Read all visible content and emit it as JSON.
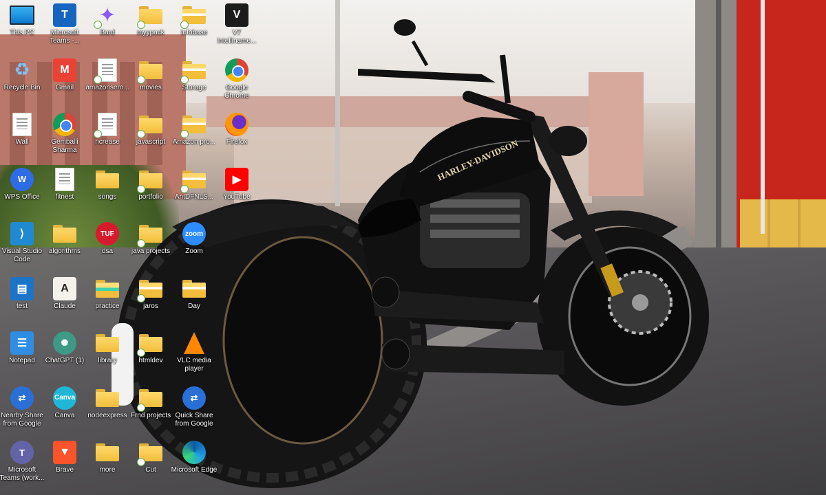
{
  "desktop": {
    "icons": [
      {
        "label": "This PC",
        "kind": "monitor",
        "color": "#1e90ff"
      },
      {
        "label": "Recycle Bin",
        "kind": "recycle",
        "color": "#7bc5ff"
      },
      {
        "label": "Wall",
        "kind": "doc",
        "color": "#ffffff"
      },
      {
        "label": "WPS Office",
        "kind": "round",
        "glyph": "W",
        "color": "#2e6be6"
      },
      {
        "label": "Visual Studio Code",
        "kind": "square",
        "glyph": "⟩",
        "color": "#1f8ad2"
      },
      {
        "label": "test",
        "kind": "square",
        "glyph": "▤",
        "color": "#1c74c9"
      },
      {
        "label": "Notepad",
        "kind": "square",
        "glyph": "☰",
        "color": "#2f8de4"
      },
      {
        "label": "Nearby Share from Google",
        "kind": "round",
        "glyph": "⇄",
        "color": "#2a6fd6"
      },
      {
        "label": "Microsoft Teams (work...",
        "kind": "round",
        "glyph": "T",
        "color": "#6264a7"
      },
      {
        "label": "Microsoft Teams -...",
        "kind": "square",
        "glyph": "T",
        "color": "#1565c0"
      },
      {
        "label": "Gmail",
        "kind": "square",
        "glyph": "M",
        "color": "#ea4335"
      },
      {
        "label": "Gemballi Sharma",
        "kind": "chrome",
        "color": "#4285f4"
      },
      {
        "label": "fitnest",
        "kind": "doc",
        "color": "#ffffff"
      },
      {
        "label": "algorithms",
        "kind": "folder",
        "color": "#f2be3b"
      },
      {
        "label": "Claude",
        "kind": "square",
        "glyph": "A",
        "color": "#f5f2ee"
      },
      {
        "label": "ChatGPT (1)",
        "kind": "round",
        "glyph": "✺",
        "color": "#3c9a85"
      },
      {
        "label": "Canva",
        "kind": "round",
        "glyph": "Canva",
        "color": "#20b7d6"
      },
      {
        "label": "Brave",
        "kind": "square",
        "glyph": "▼",
        "color": "#fb542b"
      },
      {
        "label": "Bard",
        "kind": "sparkle",
        "color": "#8a5cf6"
      },
      {
        "label": "amazonsero...",
        "kind": "doc",
        "color": "#ffffff"
      },
      {
        "label": "ncrease",
        "kind": "doc",
        "color": "#ffffff"
      },
      {
        "label": "songs",
        "kind": "folder",
        "color": "#f2be3b"
      },
      {
        "label": "dsa",
        "kind": "round",
        "glyph": "TUF",
        "color": "#d81b2c"
      },
      {
        "label": "practice",
        "kind": "folder-green",
        "color": "#3fd3b0"
      },
      {
        "label": "library",
        "kind": "folder",
        "color": "#f2be3b"
      },
      {
        "label": "nodeexpress",
        "kind": "folder",
        "color": "#f2be3b"
      },
      {
        "label": "more",
        "kind": "folder",
        "color": "#f2be3b"
      },
      {
        "label": "myypack",
        "kind": "folder",
        "color": "#f2be3b"
      },
      {
        "label": "movies",
        "kind": "folder",
        "color": "#f2be3b"
      },
      {
        "label": "javascript",
        "kind": "folder",
        "color": "#f2be3b"
      },
      {
        "label": "portfolio",
        "kind": "folder",
        "color": "#f2be3b"
      },
      {
        "label": "java projects",
        "kind": "folder",
        "color": "#f2be3b"
      },
      {
        "label": "jaros",
        "kind": "folder-docs",
        "color": "#f2be3b"
      },
      {
        "label": "htmldev",
        "kind": "folder",
        "color": "#f2be3b"
      },
      {
        "label": "Frnd projects",
        "kind": "folder",
        "color": "#f2be3b"
      },
      {
        "label": "Cut",
        "kind": "folder",
        "color": "#f2be3b"
      },
      {
        "label": "Infobase",
        "kind": "folder-docs",
        "color": "#f2be3b"
      },
      {
        "label": "Storage",
        "kind": "folder-docs",
        "color": "#f2be3b"
      },
      {
        "label": "Amazon pro...",
        "kind": "folder-docs",
        "color": "#f2be3b"
      },
      {
        "label": "AntDFNLS...",
        "kind": "folder-docs",
        "color": "#f2be3b"
      },
      {
        "label": "Zoom",
        "kind": "round",
        "glyph": "zoom",
        "color": "#2d8cff"
      },
      {
        "label": "Day",
        "kind": "folder-docs",
        "color": "#f2be3b"
      },
      {
        "label": "VLC media player",
        "kind": "vlc",
        "color": "#ff8800"
      },
      {
        "label": "Quick Share from Google",
        "kind": "round",
        "glyph": "⇄",
        "color": "#2a6fd6"
      },
      {
        "label": "Microsoft Edge",
        "kind": "edge",
        "color": "#1ea1e5"
      },
      {
        "label": "V7 Intelliname...",
        "kind": "square",
        "glyph": "V",
        "color": "#1b1b1b"
      },
      {
        "label": "Google Chrome",
        "kind": "chrome",
        "color": "#4285f4"
      },
      {
        "label": "Firefox",
        "kind": "firefox",
        "color": "#ff9500"
      },
      {
        "label": "YouTube",
        "kind": "square",
        "glyph": "▶",
        "color": "#ff0000"
      }
    ]
  },
  "wallpaper": {
    "brand_text": "HARLEY-DAVIDSON"
  }
}
